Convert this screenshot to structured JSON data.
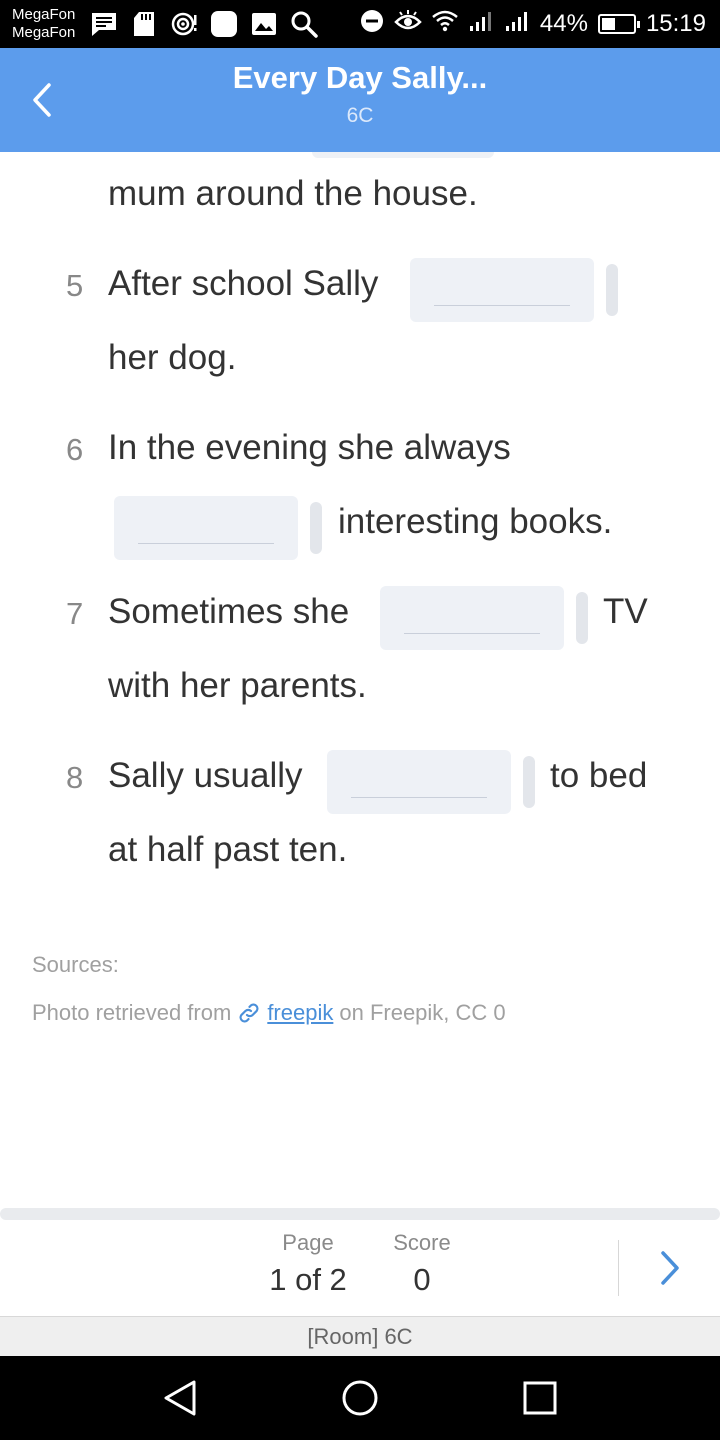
{
  "status_bar": {
    "carrier_line1": "MegaFon",
    "carrier_line2": "MegaFon",
    "battery": "44%",
    "battery_level": 0.44,
    "time": "15:19"
  },
  "header": {
    "title": "Every Day Sally...",
    "subtitle": "6C"
  },
  "exercise": {
    "partial_line": "mum around the house.",
    "items": [
      {
        "number": "5",
        "before": "After school Sally",
        "after": "her dog."
      },
      {
        "number": "6",
        "before": "In the evening she always",
        "after": "interesting books."
      },
      {
        "number": "7",
        "before": "Sometimes she",
        "after_inline": "TV",
        "after": "with her parents."
      },
      {
        "number": "8",
        "before": "Sally usually",
        "after_inline": "to bed",
        "after": "at half past ten."
      }
    ]
  },
  "sources": {
    "label": "Sources:",
    "prefix": "Photo retrieved from",
    "link_text": "freepik",
    "suffix": "on Freepik, CC 0"
  },
  "footer": {
    "page_label": "Page",
    "page_value": "1 of 2",
    "score_label": "Score",
    "score_value": "0",
    "room": "[Room] 6C"
  },
  "colors": {
    "header_bg": "#5c9cec",
    "link": "#4a8fd9"
  }
}
